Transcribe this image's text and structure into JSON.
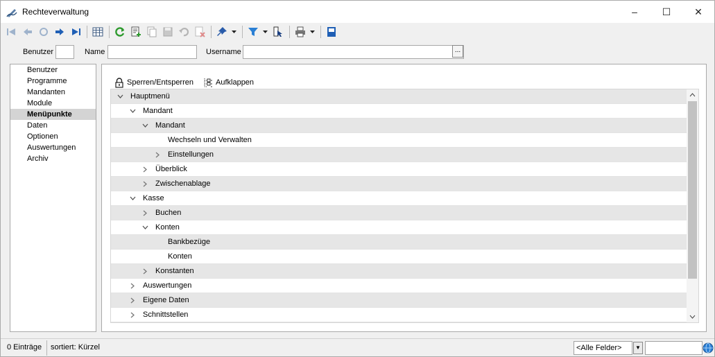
{
  "window": {
    "title": "Rechteverwaltung",
    "controls": {
      "minimize": "–",
      "maximize": "☐",
      "close": "✕"
    }
  },
  "toolbar": {
    "icons": [
      "first-record-icon",
      "previous-record-icon",
      "refresh-record-icon",
      "next-record-icon",
      "last-record-icon",
      "table-view-icon",
      "reload-icon",
      "new-record-icon",
      "copy-record-icon",
      "save-icon",
      "undo-icon",
      "delete-icon",
      "pin-icon",
      "filter-icon",
      "column-select-icon",
      "print-icon",
      "export-icon"
    ]
  },
  "filter": {
    "benutzer_label": "Benutzer",
    "benutzer_value": "",
    "name_label": "Name",
    "name_value": "",
    "username_label": "Username",
    "username_value": "",
    "ellipsis": "..."
  },
  "nav": {
    "items": [
      {
        "label": "Benutzer",
        "selected": false
      },
      {
        "label": "Programme",
        "selected": false
      },
      {
        "label": "Mandanten",
        "selected": false
      },
      {
        "label": "Module",
        "selected": false
      },
      {
        "label": "Menüpunkte",
        "selected": true
      },
      {
        "label": "Daten",
        "selected": false
      },
      {
        "label": "Optionen",
        "selected": false
      },
      {
        "label": "Auswertungen",
        "selected": false
      },
      {
        "label": "Archiv",
        "selected": false
      }
    ]
  },
  "actions": {
    "lock": "Sperren/Entsperren",
    "expand": "Aufklappen"
  },
  "tree": {
    "rows": [
      {
        "label": "Hauptmenü",
        "level": 0,
        "state": "expanded"
      },
      {
        "label": "Mandant",
        "level": 1,
        "state": "expanded"
      },
      {
        "label": "Mandant",
        "level": 2,
        "state": "expanded"
      },
      {
        "label": "Wechseln und Verwalten",
        "level": 3,
        "state": "leaf"
      },
      {
        "label": "Einstellungen",
        "level": 3,
        "state": "collapsed"
      },
      {
        "label": "Überblick",
        "level": 2,
        "state": "collapsed"
      },
      {
        "label": "Zwischenablage",
        "level": 2,
        "state": "collapsed"
      },
      {
        "label": "Kasse",
        "level": 1,
        "state": "expanded"
      },
      {
        "label": "Buchen",
        "level": 2,
        "state": "collapsed"
      },
      {
        "label": "Konten",
        "level": 2,
        "state": "expanded"
      },
      {
        "label": "Bankbezüge",
        "level": 3,
        "state": "leaf"
      },
      {
        "label": "Konten",
        "level": 3,
        "state": "leaf"
      },
      {
        "label": "Konstanten",
        "level": 2,
        "state": "collapsed"
      },
      {
        "label": "Auswertungen",
        "level": 1,
        "state": "collapsed"
      },
      {
        "label": "Eigene Daten",
        "level": 1,
        "state": "collapsed"
      },
      {
        "label": "Schnittstellen",
        "level": 1,
        "state": "collapsed"
      }
    ]
  },
  "status": {
    "count": "0 Einträge",
    "sort": "sortiert: Kürzel",
    "field_select": "<Alle Felder>",
    "search_value": ""
  }
}
